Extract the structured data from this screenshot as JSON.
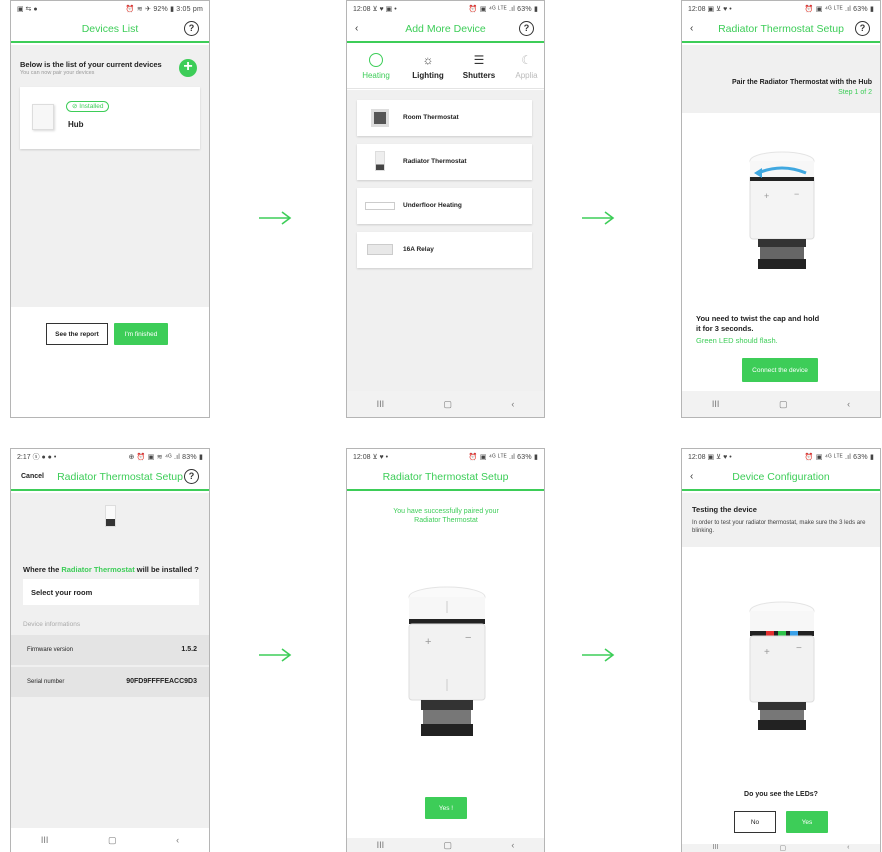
{
  "arrow_color": "#3dcd58",
  "accent": "#3dcd58",
  "s1": {
    "status_left": "▣ ⇆ ●",
    "status_right": "⏰ ≋ ✈ 92% ▮ 3:05 pm",
    "title": "Devices List",
    "help": "?",
    "heading": "Below is the list of your current devices",
    "subheading": "You can now pair your devices",
    "badge": "Installed",
    "device": "Hub",
    "see_report": "See the report",
    "finished": "I'm finished"
  },
  "s2": {
    "status_left": "12:08 ⊻ ♥ ▣ •",
    "status_right": "⏰ ▣ ⁴ᴳ ᴸᵀᴱ .ıl 63% ▮",
    "back": "‹",
    "title": "Add More Device",
    "help": "?",
    "categories": [
      "Heating",
      "Lighting",
      "Shutters",
      "Applia"
    ],
    "devices": [
      "Room Thermostat",
      "Radiator Thermostat",
      "Underfloor Heating",
      "16A Relay"
    ],
    "nav": [
      "III",
      "▢",
      "‹"
    ]
  },
  "s3": {
    "status_left": "12:08 ▣ ⊻ ♥ •",
    "status_right": "⏰ ▣ ⁴ᴳ ᴸᵀᴱ .ıl 63% ▮",
    "back": "‹",
    "title": "Radiator Thermostat Setup",
    "help": "?",
    "pair_text": "Pair the Radiator Thermostat with the Hub",
    "step": "Step 1 of 2",
    "instruction": "You need to twist the cap and hold it for 3 seconds.",
    "led_text": "Green LED should flash.",
    "connect": "Connect the device",
    "nav": [
      "III",
      "▢",
      "‹"
    ]
  },
  "s4": {
    "status_left": "2:17 ⓢ ● ● •",
    "status_right": "⊕ ⏰ ▣ ≋ ⁴ᴳ .ıl 83% ▮",
    "cancel": "Cancel",
    "title": "Radiator Thermostat Setup",
    "help": "?",
    "question_pre": "Where the ",
    "question_green": "Radiator Thermostat",
    "question_post": " will be installed ?",
    "select_room": "Select your room",
    "info_label": "Device informations",
    "firmware_label": "Firmware version",
    "firmware_value": "1.5.2",
    "serial_label": "Serial number",
    "serial_value": "90FD9FFFFEACC9D3",
    "nav": [
      "III",
      "▢",
      "‹"
    ]
  },
  "s5": {
    "status_left": "12:08 ⊻ ♥ •",
    "status_right": "⏰ ▣ ⁴ᴳ ᴸᵀᴱ .ıl 63% ▮",
    "title": "Radiator Thermostat Setup",
    "success": "You have successfully paired your Radiator Thermostat",
    "yes": "Yes !",
    "nav": [
      "III",
      "▢",
      "‹"
    ]
  },
  "s6": {
    "status_left": "12:08 ▣ ⊻ ♥ •",
    "status_right": "⏰ ▣ ⁴ᴳ ᴸᵀᴱ .ıl 63% ▮",
    "back": "‹",
    "title": "Device Configuration",
    "testing": "Testing the device",
    "testing_desc": "In order to test your radiator thermostat, make sure the 3 leds are blinking.",
    "question": "Do you see the LEDs?",
    "no": "No",
    "yes": "Yes",
    "nav": [
      "III",
      "▢",
      "‹"
    ]
  }
}
